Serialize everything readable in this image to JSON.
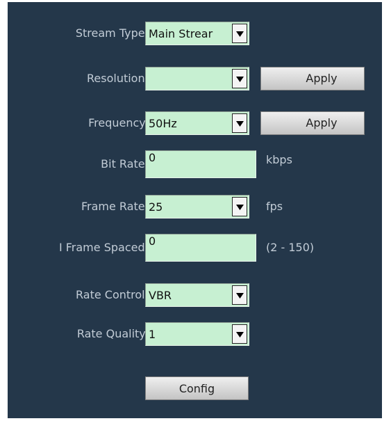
{
  "form": {
    "stream_type": {
      "label": "Stream Type:",
      "value": "Main Strear"
    },
    "resolution": {
      "label": "Resolution:",
      "value": "",
      "apply_label": "Apply"
    },
    "frequency": {
      "label": "Frequency:",
      "value": "50Hz",
      "apply_label": "Apply"
    },
    "bit_rate": {
      "label": "Bit Rate:",
      "value": "0",
      "unit": "kbps"
    },
    "frame_rate": {
      "label": "Frame Rate:",
      "value": "25",
      "unit": "fps"
    },
    "i_frame_spaced": {
      "label": "I Frame Spaced:",
      "value": "0",
      "range": "(2 - 150)"
    },
    "rate_control": {
      "label": "Rate Control:",
      "value": "VBR"
    },
    "rate_quality": {
      "label": "Rate Quality:",
      "value": "1"
    },
    "config_label": "Config"
  },
  "colors": {
    "panel_background": "#24374a",
    "field_background": "#c7f0d2",
    "label_text": "#c2ccd6"
  },
  "icons": {
    "dropdown": "triangle-down-icon"
  }
}
